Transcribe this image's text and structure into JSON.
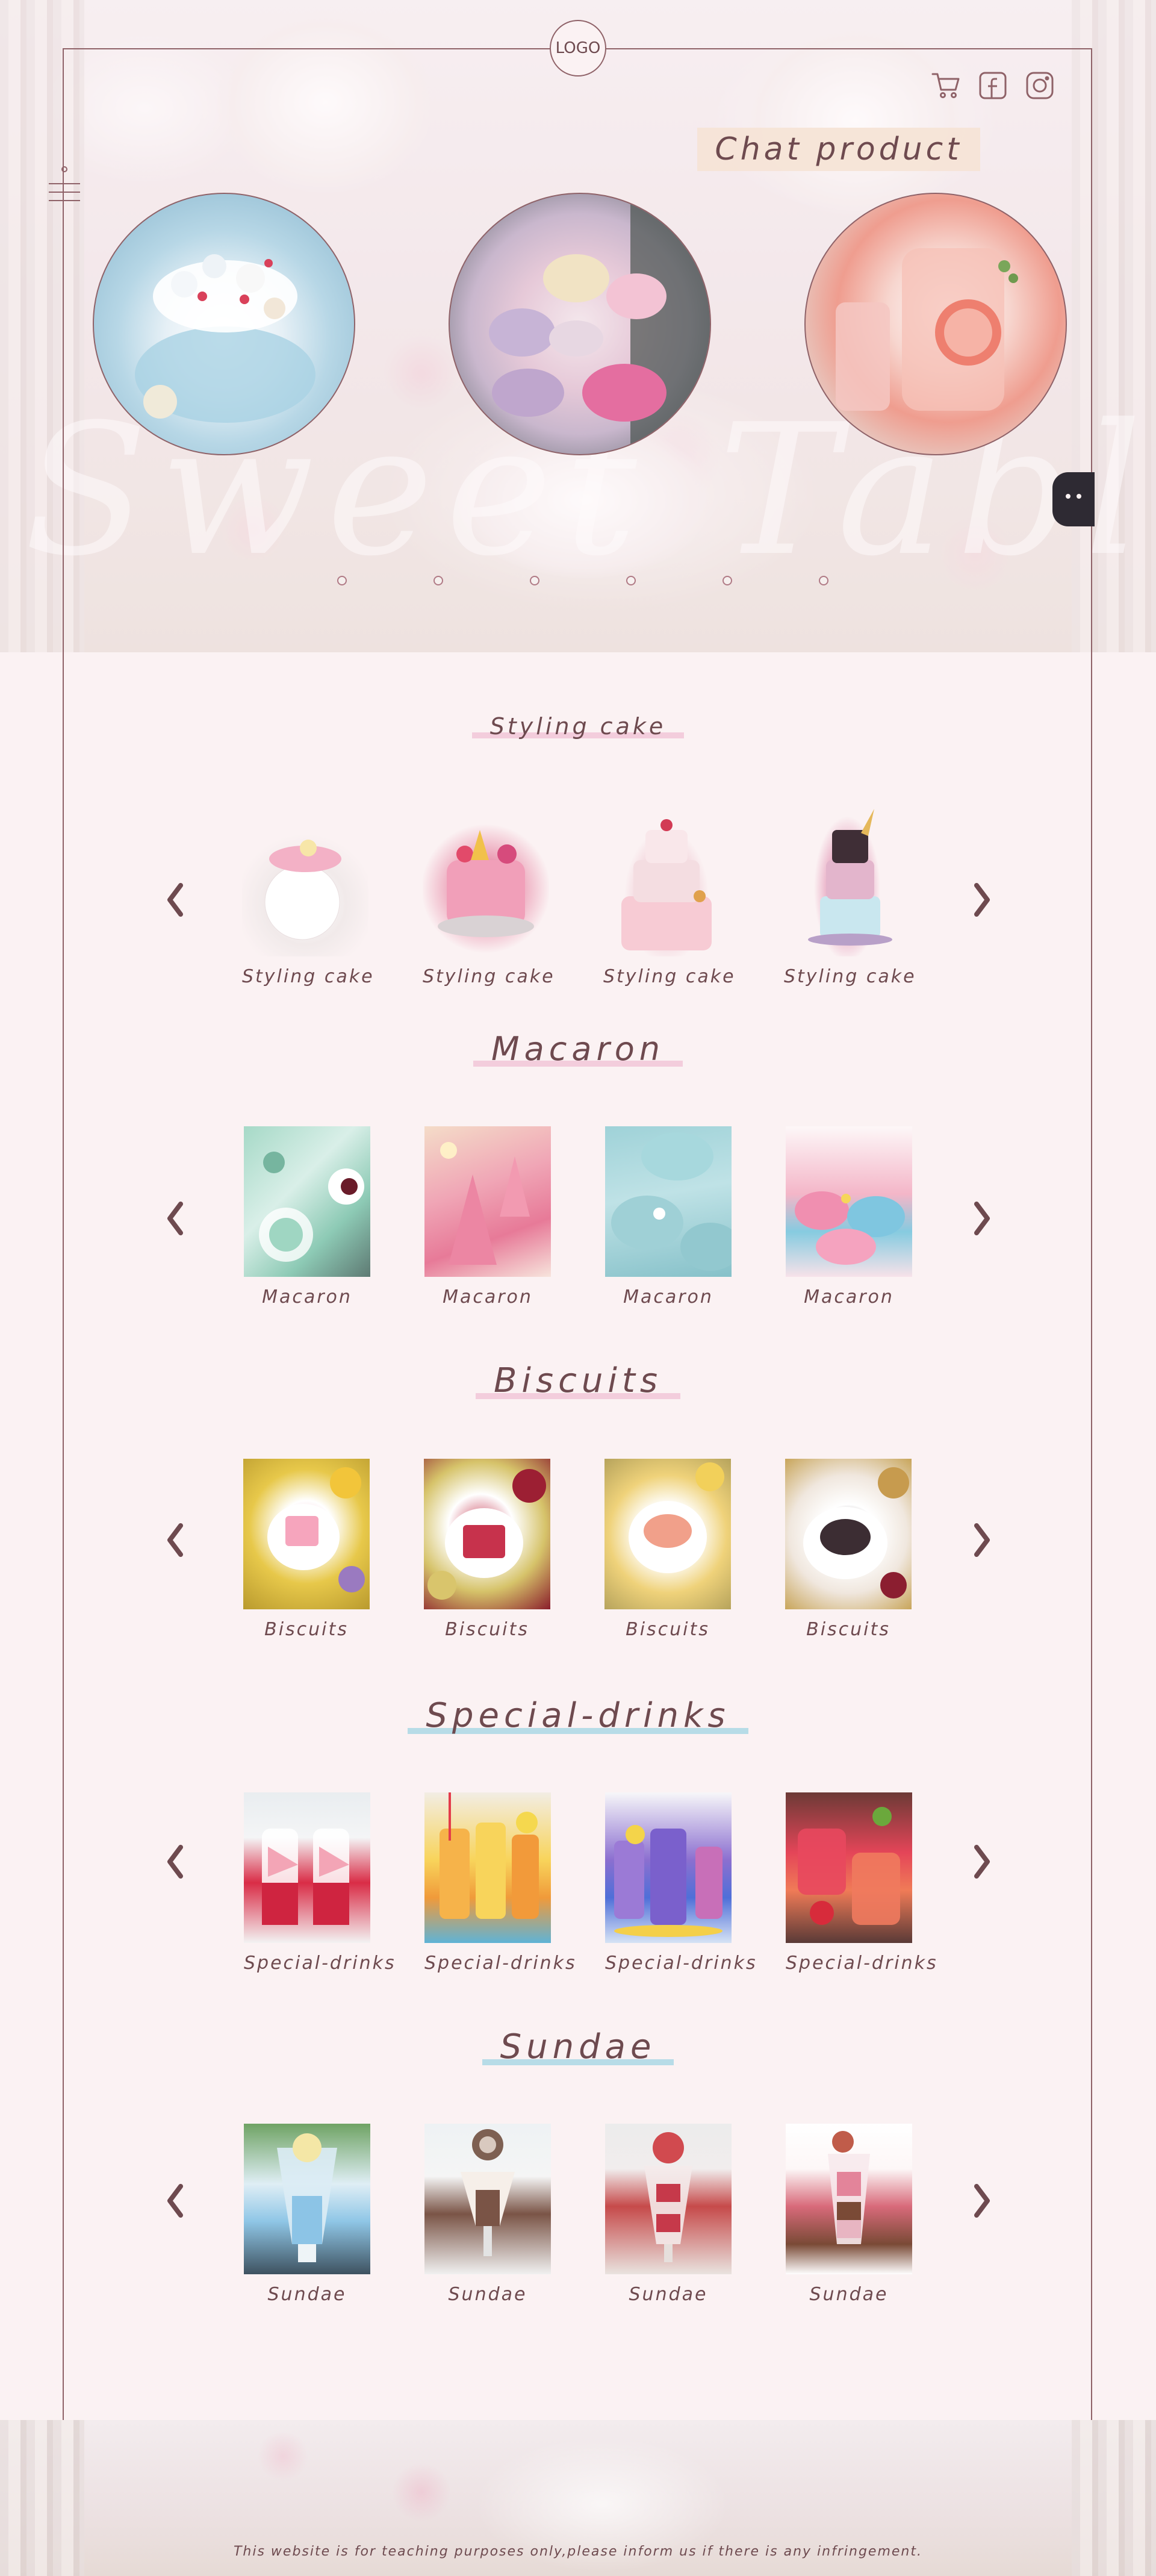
{
  "header": {
    "logo": "LOGO",
    "title": "Chat product",
    "icons": [
      "cart-icon",
      "facebook-icon",
      "instagram-icon"
    ]
  },
  "hero": {
    "slides": [
      "blue-cake-photo",
      "macaron-cookies-photo",
      "grapefruit-drink-photo"
    ],
    "dot_count": 6,
    "script_text": "Sweet Table"
  },
  "categories": [
    {
      "title": "Styling cake",
      "underline": "#f3cddc",
      "items": [
        "Styling cake",
        "Styling cake",
        "Styling cake",
        "Styling cake"
      ]
    },
    {
      "title": "Macaron",
      "underline": "#f3cddc",
      "items": [
        "Macaron",
        "Macaron",
        "Macaron",
        "Macaron"
      ]
    },
    {
      "title": "Biscuits",
      "underline": "#f3cddc",
      "items": [
        "Biscuits",
        "Biscuits",
        "Biscuits",
        "Biscuits"
      ]
    },
    {
      "title": "Special-drinks",
      "underline": "#b7dce7",
      "items": [
        "Special-drinks",
        "Special-drinks",
        "Special-drinks",
        "Special-drinks"
      ]
    },
    {
      "title": "Sundae",
      "underline": "#b7dce7",
      "items": [
        "Sundae",
        "Sundae",
        "Sundae",
        "Sundae"
      ]
    }
  ],
  "footer": {
    "text": "This website is for teaching purposes only,please inform us if there is any infringement."
  },
  "colors": {
    "background": "#fbf2f3",
    "frame": "#8f6268",
    "text": "#6e4a4f",
    "arrow": "#6e4a4f",
    "title_bg": "#f6e4d6"
  }
}
